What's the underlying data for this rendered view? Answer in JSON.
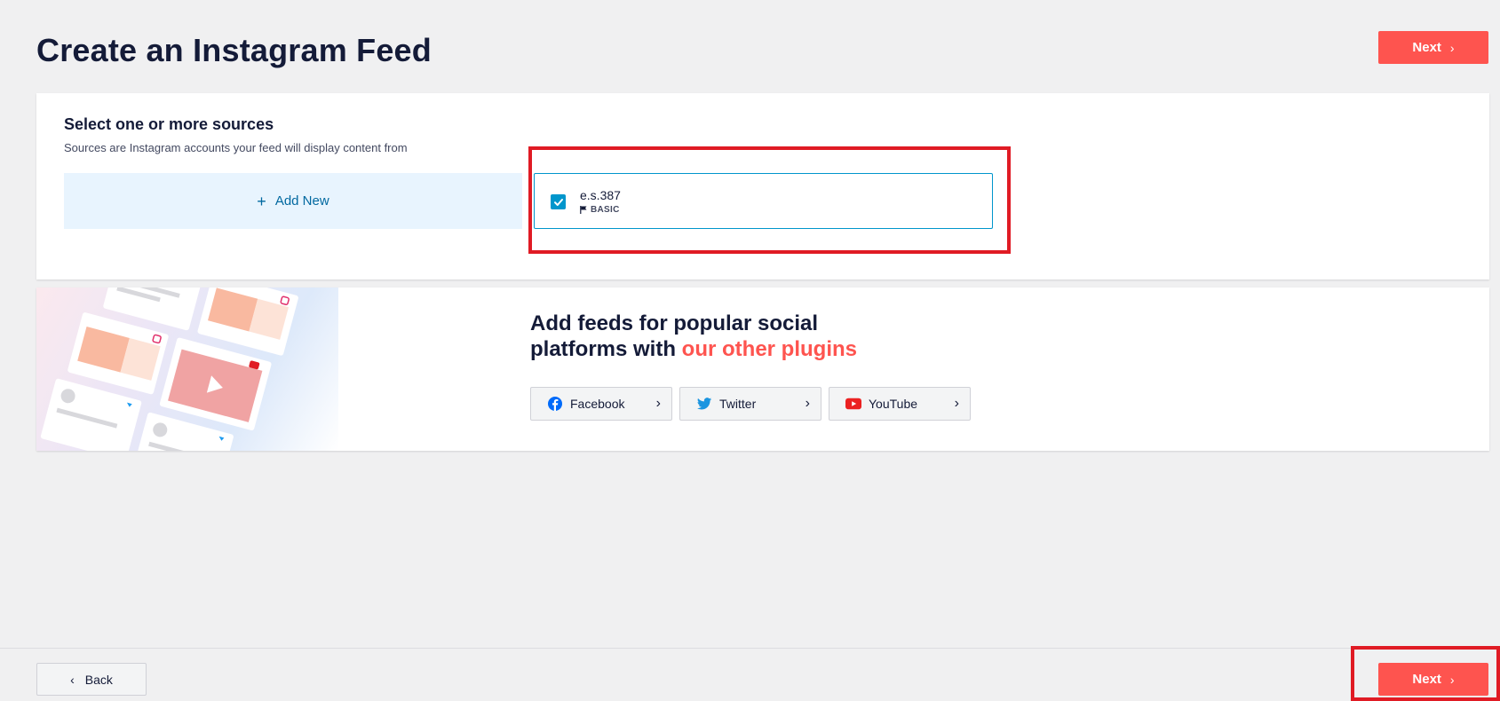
{
  "header": {
    "title": "Create an Instagram Feed",
    "next_label": "Next"
  },
  "sources": {
    "title": "Select one or more sources",
    "description": "Sources are Instagram accounts your feed will display content from",
    "add_new_label": "Add New",
    "items": [
      {
        "name": "e.s.387",
        "type": "BASIC",
        "checked": true
      }
    ]
  },
  "plugins": {
    "heading_line1": "Add feeds for popular social",
    "heading_line2_prefix": "platforms with ",
    "heading_line2_accent": "our other plugins",
    "buttons": [
      {
        "label": "Facebook",
        "icon": "facebook-icon"
      },
      {
        "label": "Twitter",
        "icon": "twitter-icon"
      },
      {
        "label": "YouTube",
        "icon": "youtube-icon"
      }
    ]
  },
  "footer": {
    "back_label": "Back",
    "next_label": "Next"
  },
  "colors": {
    "accent": "#fe544f",
    "primary_blue": "#0096cc",
    "highlight": "#e01b24"
  }
}
